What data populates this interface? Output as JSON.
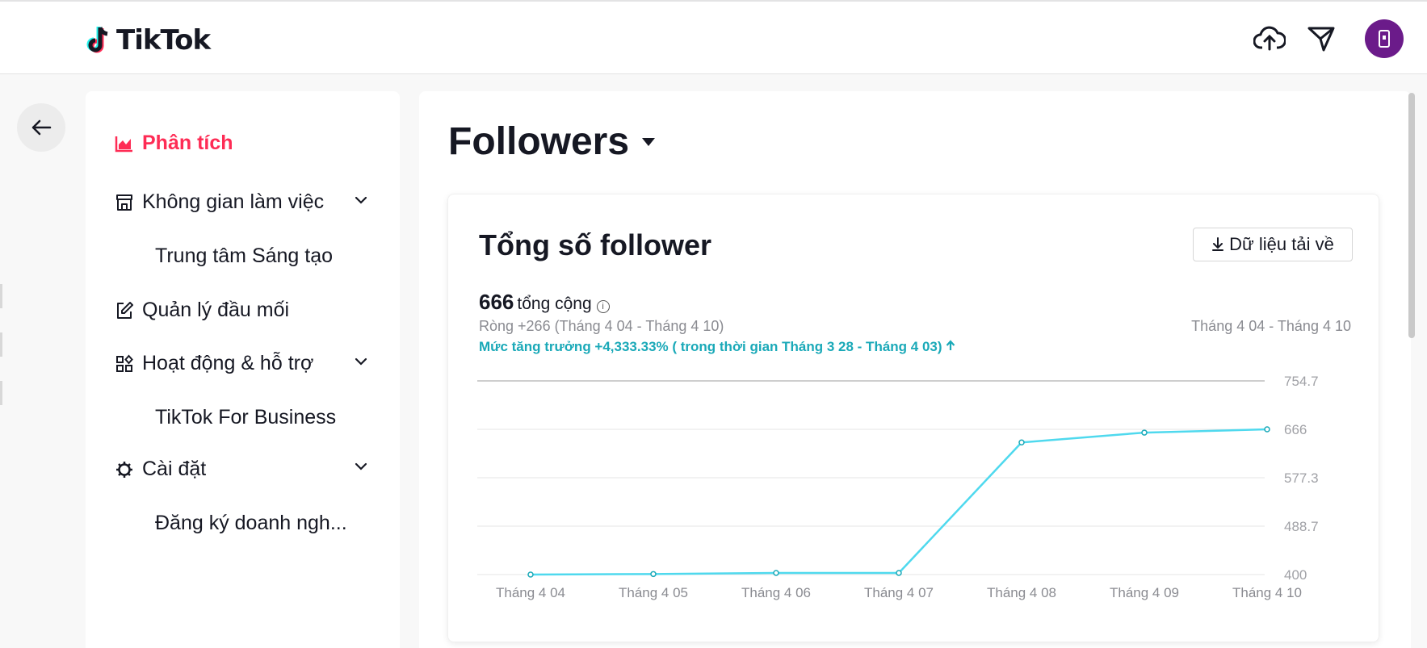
{
  "app": {
    "brand": "TikTok"
  },
  "sidebar": {
    "items": [
      {
        "label": "Phân tích"
      },
      {
        "label": "Không gian làm việc"
      },
      {
        "label": "Trung tâm Sáng tạo"
      },
      {
        "label": "Quản lý đầu mối"
      },
      {
        "label": "Hoạt động & hỗ trợ"
      },
      {
        "label": "TikTok For Business"
      },
      {
        "label": "Cài đặt"
      },
      {
        "label": "Đăng ký doanh ngh..."
      }
    ]
  },
  "page": {
    "title": "Followers"
  },
  "card": {
    "title": "Tổng số follower",
    "download_label": "Dữ liệu tải về",
    "total_value": "666",
    "total_label": "tổng cộng",
    "net_text": "Ròng +266 (Tháng 4 04 - Tháng 4 10)",
    "range_text": "Tháng 4 04 - Tháng 4 10",
    "growth_text": "Mức tăng trưởng +4,333.33% ( trong thời gian Tháng 3 28 - Tháng 4 03)"
  },
  "colors": {
    "accent": "#fe2c55",
    "line": "#4fd9ee",
    "growth": "#1aa9b8"
  },
  "chart_data": {
    "type": "line",
    "categories": [
      "Tháng 4 04",
      "Tháng 4 05",
      "Tháng 4 06",
      "Tháng 4 07",
      "Tháng 4 08",
      "Tháng 4 09",
      "Tháng 4 10"
    ],
    "series": [
      {
        "values": [
          400,
          401,
          403,
          403,
          642,
          660,
          666
        ]
      }
    ],
    "yticks": [
      "754.7",
      "666",
      "577.3",
      "488.7",
      "400"
    ],
    "ylim": [
      400,
      754.7
    ],
    "grid": true
  }
}
